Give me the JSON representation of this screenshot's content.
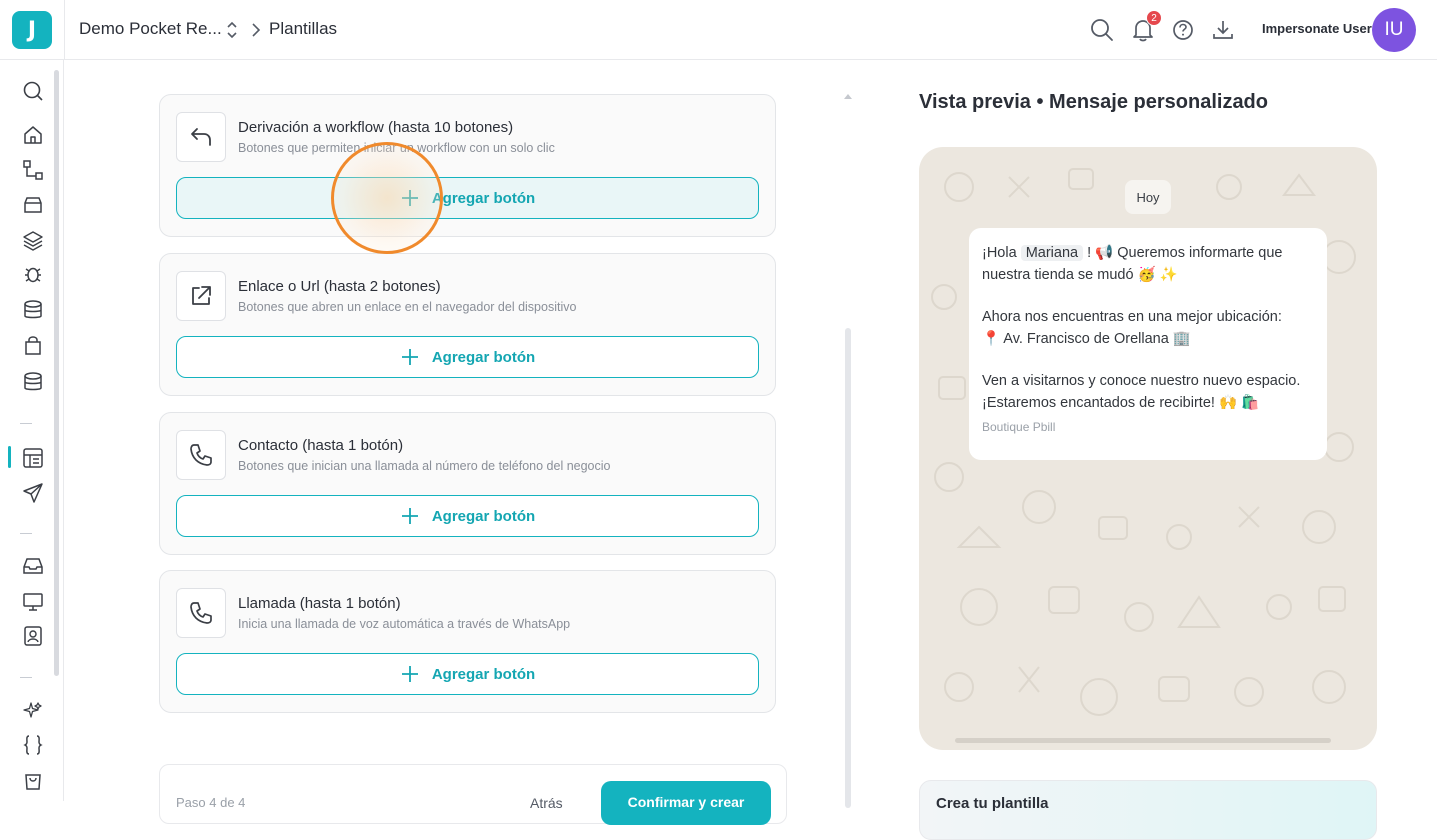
{
  "header": {
    "workspace": "Demo Pocket Re...",
    "breadcrumb_current": "Plantillas",
    "notification_count": "2",
    "user_name": "Impersonate User",
    "avatar_initials": "IU"
  },
  "cards": [
    {
      "title": "Derivación a workflow (hasta 10 botones)",
      "subtitle": "Botones que permiten iniciar un workflow con un solo clic",
      "button": "Agregar botón",
      "icon": "return-arrow-icon"
    },
    {
      "title": "Enlace o Url (hasta 2 botones)",
      "subtitle": "Botones que abren un enlace en el navegador del dispositivo",
      "button": "Agregar botón",
      "icon": "external-link-icon"
    },
    {
      "title": "Contacto (hasta 1 botón)",
      "subtitle": "Botones que inician una llamada al número de teléfono del negocio",
      "button": "Agregar botón",
      "icon": "phone-icon"
    },
    {
      "title": "Llamada (hasta 1 botón)",
      "subtitle": "Inicia una llamada de voz automática a través de WhatsApp",
      "button": "Agregar botón",
      "icon": "phone-icon"
    }
  ],
  "footer": {
    "step": "Paso 4 de 4",
    "back": "Atrás",
    "confirm": "Confirmar y crear"
  },
  "preview": {
    "title": "Vista previa • Mensaje personalizado",
    "day": "Hoy",
    "greeting_prefix": "¡Hola ",
    "variable": "Mariana",
    "greeting_suffix": " ! 📢 Queremos informarte que",
    "line2": "nuestra tienda se mudó 🥳 ✨",
    "line3": "Ahora nos encuentras en una mejor ubicación:",
    "line4": "📍 Av. Francisco de Orellana 🏢",
    "line5": "Ven a visitarnos y conoce nuestro nuevo espacio.",
    "line6": "¡Estaremos encantados de recibirte! 🙌 🛍️",
    "brand": "Boutique Pbill"
  },
  "create_card": {
    "title": "Crea tu plantilla"
  },
  "colors": {
    "accent": "#14b3bf",
    "avatar": "#7d53e0",
    "badge": "#e5484d",
    "click_marker": "#f08a2c"
  }
}
